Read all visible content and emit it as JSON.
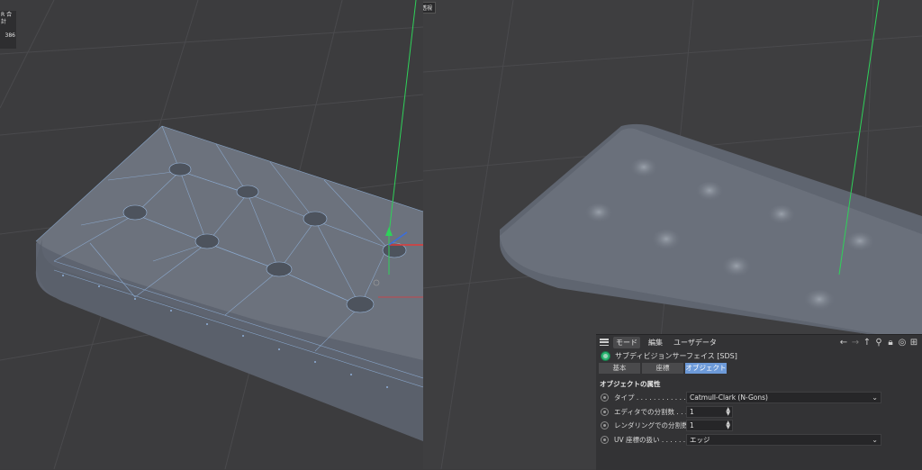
{
  "viewport_left": {
    "stats_label": "R 合計",
    "stats_value": "386"
  },
  "viewport_right": {
    "label": "透視"
  },
  "attribute_panel": {
    "menu": [
      "モード",
      "編集",
      "ユーザデータ"
    ],
    "object_name": "サブディビジョンサーフェイス [SDS]",
    "tabs": [
      "基本",
      "座標",
      "オブジェクト"
    ],
    "active_tab": "オブジェクト",
    "section_title": "オブジェクトの属性",
    "params": [
      {
        "label": "タイプ . . . . . . . . . . . . .",
        "value": "Catmull-Clark (N-Gons)",
        "kind": "dropdown"
      },
      {
        "label": "エディタでの分割数 . . .",
        "value": "1",
        "kind": "number"
      },
      {
        "label": "レンダリングでの分割数",
        "value": "1",
        "kind": "number"
      },
      {
        "label": "UV 座標の扱い . . . . . . .",
        "value": "エッジ",
        "kind": "dropdown"
      }
    ]
  },
  "colors": {
    "accent_tab": "#6d9ad8",
    "axis_y": "#2fd15a",
    "axis_x": "#e03a3a",
    "axis_z": "#3a6ee0"
  }
}
